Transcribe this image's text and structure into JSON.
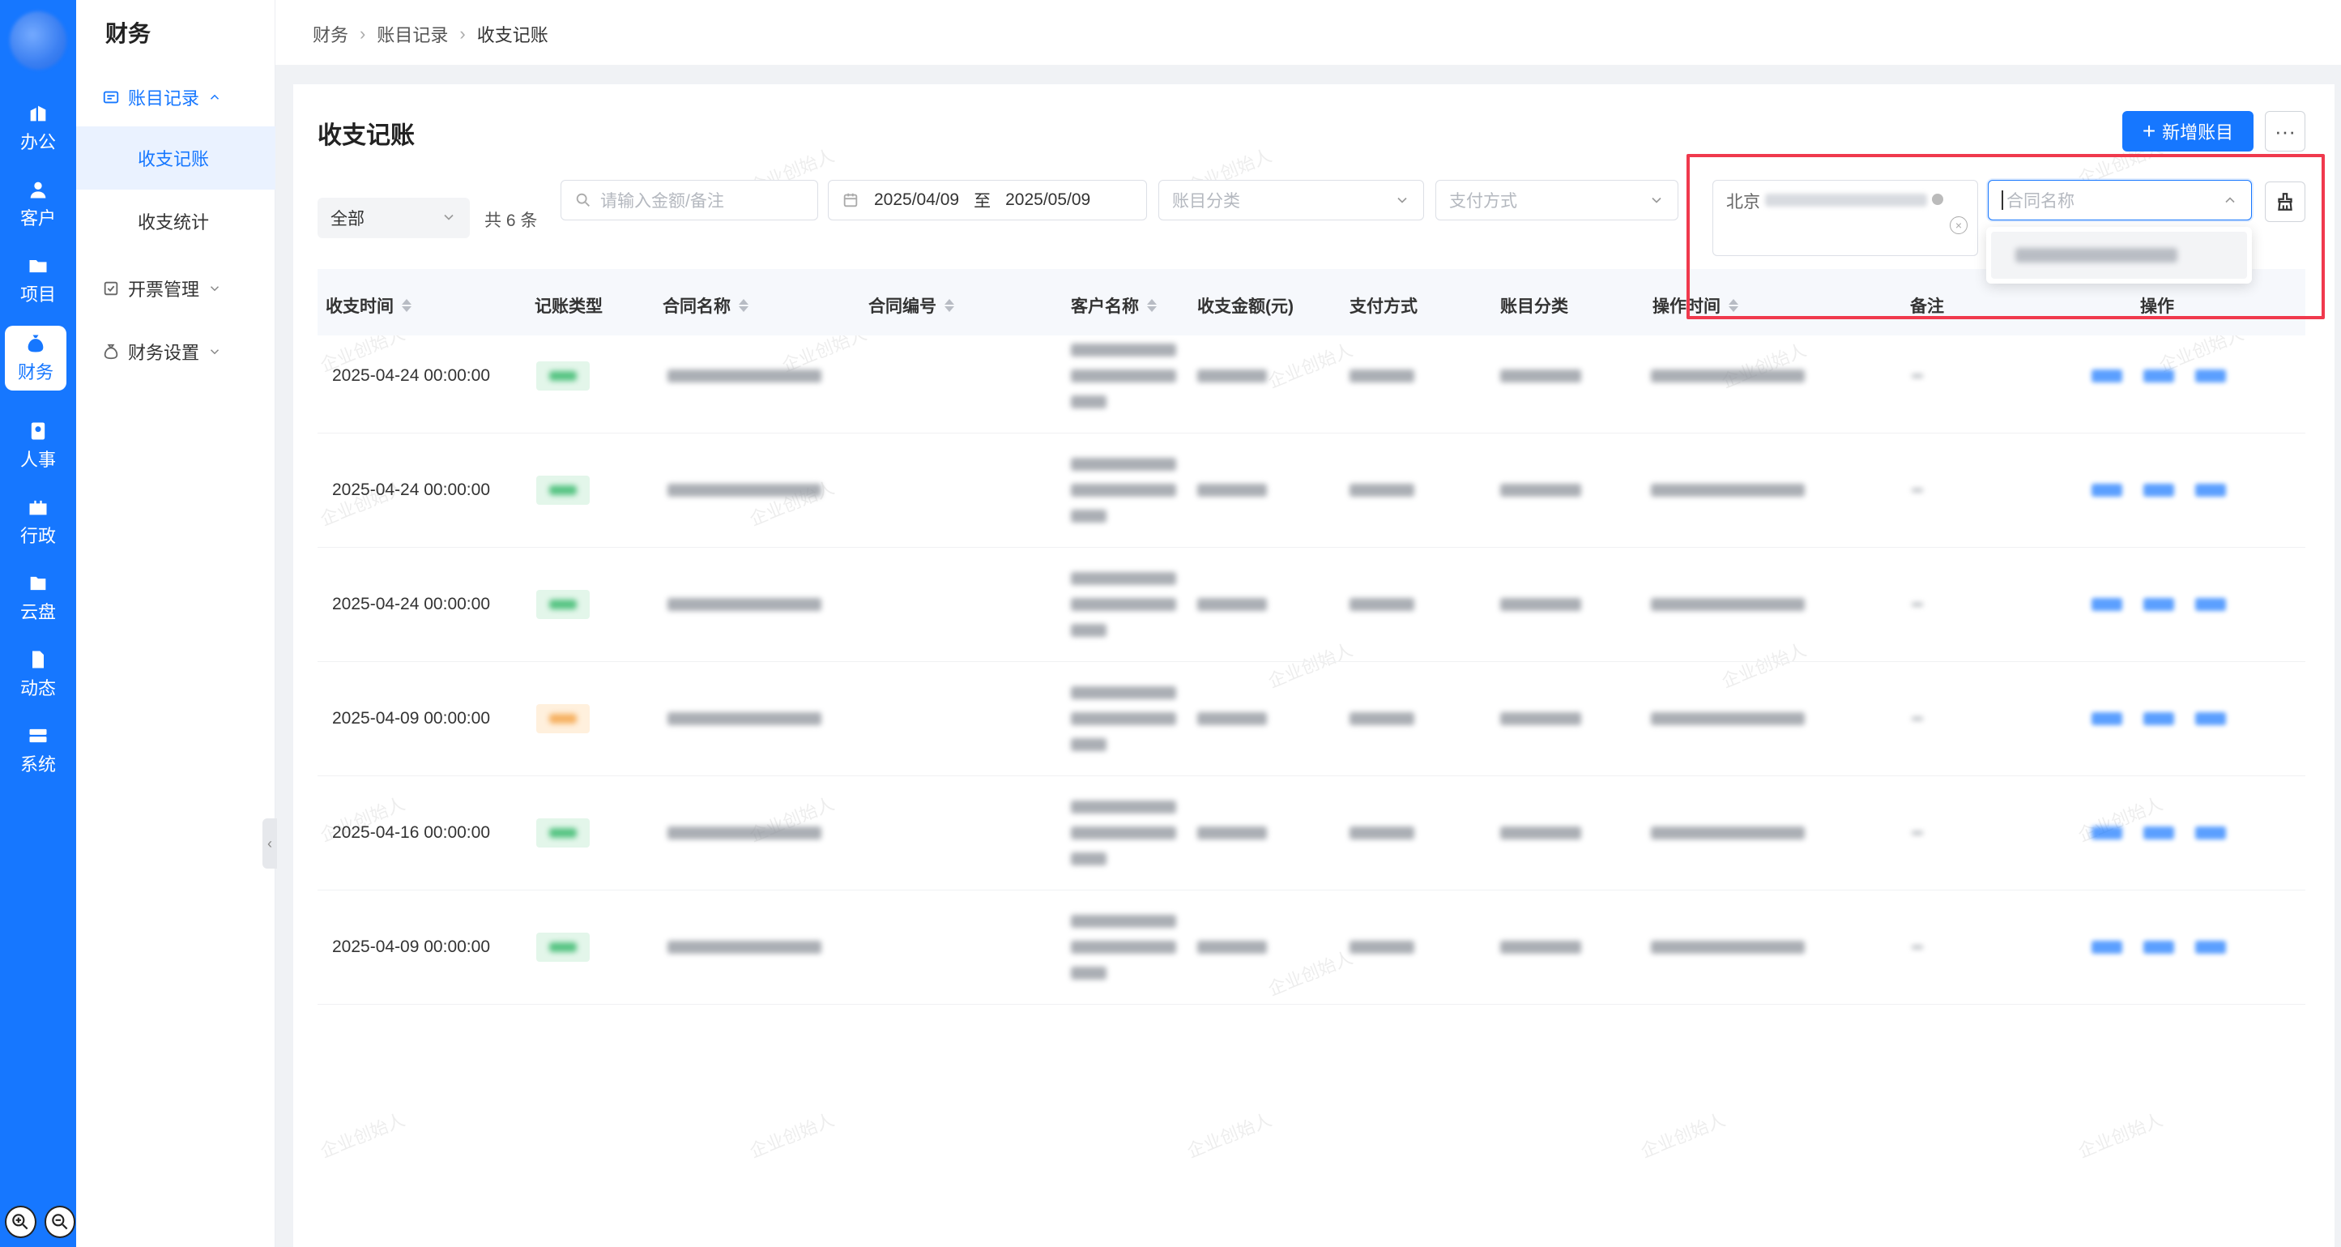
{
  "app": {
    "module_title": "财务",
    "rail_items": [
      {
        "label": "办公",
        "icon": "office-icon"
      },
      {
        "label": "客户",
        "icon": "customer-icon"
      },
      {
        "label": "项目",
        "icon": "folder-icon"
      },
      {
        "label": "财务",
        "icon": "money-bag-icon",
        "active": true
      },
      {
        "label": "人事",
        "icon": "person-badge-icon"
      },
      {
        "label": "行政",
        "icon": "briefcase-icon"
      },
      {
        "label": "云盘",
        "icon": "cloud-folder-icon"
      },
      {
        "label": "动态",
        "icon": "document-icon"
      },
      {
        "label": "系统",
        "icon": "system-icon"
      }
    ]
  },
  "sidebar": {
    "groups": [
      {
        "label": "账目记录",
        "icon": "ledger-icon",
        "open": true,
        "items": [
          {
            "label": "收支记账",
            "active": true
          },
          {
            "label": "收支统计"
          }
        ]
      },
      {
        "label": "开票管理",
        "icon": "invoice-check-icon"
      },
      {
        "label": "财务设置",
        "icon": "money-bag-outline-icon"
      }
    ]
  },
  "breadcrumb": [
    "财务",
    "账目记录",
    "收支记账"
  ],
  "page": {
    "title": "收支记账",
    "add_button": "新增账目",
    "more_button": "···"
  },
  "filters": {
    "type_value": "全部",
    "count_text": "共 6 条",
    "search_placeholder": "请输入金额/备注",
    "date_start": "2025/04/09",
    "date_sep": "至",
    "date_end": "2025/05/09",
    "category_placeholder": "账目分类",
    "payment_placeholder": "支付方式",
    "city_prefix": "北京",
    "contract_placeholder": "合同名称"
  },
  "table": {
    "headers": [
      "收支时间",
      "记账类型",
      "合同名称",
      "合同编号",
      "客户名称",
      "收支金额(元)",
      "支付方式",
      "账目分类",
      "操作时间",
      "备注",
      "操作"
    ],
    "rows": [
      {
        "time": "2025-04-24 00:00:00",
        "type": "in"
      },
      {
        "time": "2025-04-24 00:00:00",
        "type": "in"
      },
      {
        "time": "2025-04-24 00:00:00",
        "type": "in"
      },
      {
        "time": "2025-04-09 00:00:00",
        "type": "out"
      },
      {
        "time": "2025-04-16 00:00:00",
        "type": "in"
      },
      {
        "time": "2025-04-09 00:00:00",
        "type": "in"
      }
    ]
  },
  "watermark": "企业创始人",
  "colors": {
    "primary": "#1677ff",
    "highlight": "#f0394d",
    "income_tag": "#e3f6ea",
    "expense_tag": "#fff0dd"
  }
}
